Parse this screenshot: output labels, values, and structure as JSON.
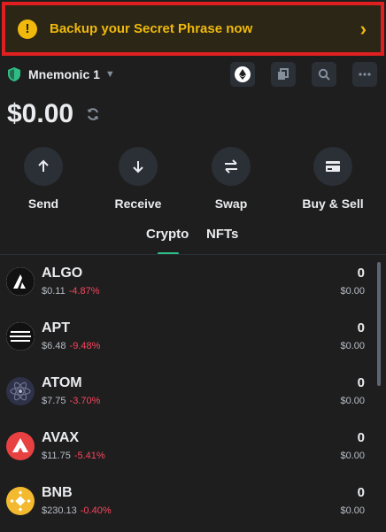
{
  "banner": {
    "text": "Backup your Secret Phrase now",
    "icon": "warning-icon",
    "chevron": "›"
  },
  "wallet": {
    "name": "Mnemonic 1",
    "caret": "▼"
  },
  "toolbar_icons": [
    "ethereum-icon",
    "copy-icon",
    "search-icon",
    "more-icon"
  ],
  "balance": {
    "amount": "$0.00"
  },
  "actions": [
    {
      "label": "Send",
      "icon": "arrow-up-icon"
    },
    {
      "label": "Receive",
      "icon": "arrow-down-icon"
    },
    {
      "label": "Swap",
      "icon": "swap-icon"
    },
    {
      "label": "Buy & Sell",
      "icon": "card-icon"
    }
  ],
  "tabs": [
    {
      "label": "Crypto",
      "active": true
    },
    {
      "label": "NFTs",
      "active": false
    }
  ],
  "assets": [
    {
      "symbol": "ALGO",
      "price": "$0.11",
      "change": "-4.87%",
      "balance": "0",
      "value": "$0.00",
      "icon": "algo-icon",
      "color": "#ffffff"
    },
    {
      "symbol": "APT",
      "price": "$6.48",
      "change": "-9.48%",
      "balance": "0",
      "value": "$0.00",
      "icon": "apt-icon",
      "color": "#ffffff"
    },
    {
      "symbol": "ATOM",
      "price": "$7.75",
      "change": "-3.70%",
      "balance": "0",
      "value": "$0.00",
      "icon": "atom-icon",
      "color": "#2e3148"
    },
    {
      "symbol": "AVAX",
      "price": "$11.75",
      "change": "-5.41%",
      "balance": "0",
      "value": "$0.00",
      "icon": "avax-icon",
      "color": "#e84142"
    },
    {
      "symbol": "BNB",
      "price": "$230.13",
      "change": "-0.40%",
      "balance": "0",
      "value": "$0.00",
      "icon": "bnb-icon",
      "color": "#f3ba2f"
    }
  ],
  "colors": {
    "accent": "#f0b90b",
    "negative": "#f6465d",
    "positive": "#2ebd85",
    "banner_border": "#e02020"
  }
}
